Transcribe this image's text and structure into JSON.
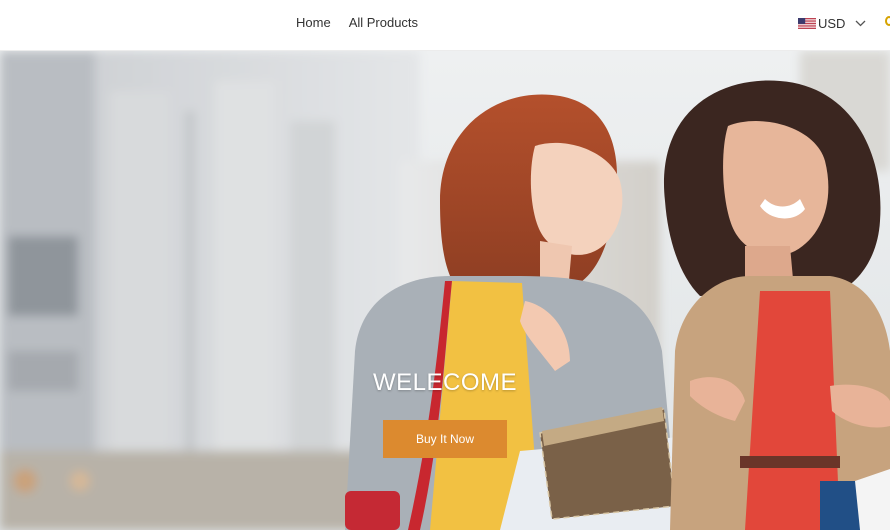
{
  "header": {
    "nav": [
      {
        "label": "Home"
      },
      {
        "label": "All Products"
      }
    ],
    "currency": {
      "flag_icon": "us-flag-icon",
      "code": "USD",
      "chevron_icon": "chevron-down-icon"
    }
  },
  "hero": {
    "heading": "WELECOME",
    "cta_label": "Buy It Now",
    "image": "two-women-shopping-photo",
    "colors": {
      "cta": "#dc8a2f",
      "heading": "#ffffff"
    }
  }
}
